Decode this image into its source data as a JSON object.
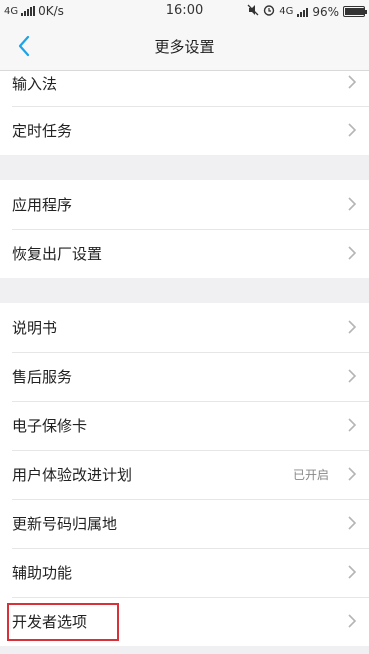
{
  "status_bar": {
    "network": "4G",
    "speed": "0K/s",
    "time": "16:00",
    "network2": "4G",
    "battery": "96%",
    "battery_level": 0.96
  },
  "header": {
    "title": "更多设置",
    "back_icon": "chevron-left-icon"
  },
  "groups": [
    {
      "items": [
        {
          "label": "输入法"
        },
        {
          "label": "定时任务"
        }
      ]
    },
    {
      "items": [
        {
          "label": "应用程序"
        },
        {
          "label": "恢复出厂设置"
        }
      ]
    },
    {
      "items": [
        {
          "label": "说明书"
        },
        {
          "label": "售后服务"
        },
        {
          "label": "电子保修卡"
        },
        {
          "label": "用户体验改进计划",
          "value": "已开启"
        },
        {
          "label": "更新号码归属地"
        },
        {
          "label": "辅助功能"
        },
        {
          "label": "开发者选项",
          "highlighted": true
        }
      ]
    }
  ],
  "colors": {
    "accent": "#1aa3e8",
    "highlight": "#d9313a",
    "background": "#f0f0f2"
  }
}
